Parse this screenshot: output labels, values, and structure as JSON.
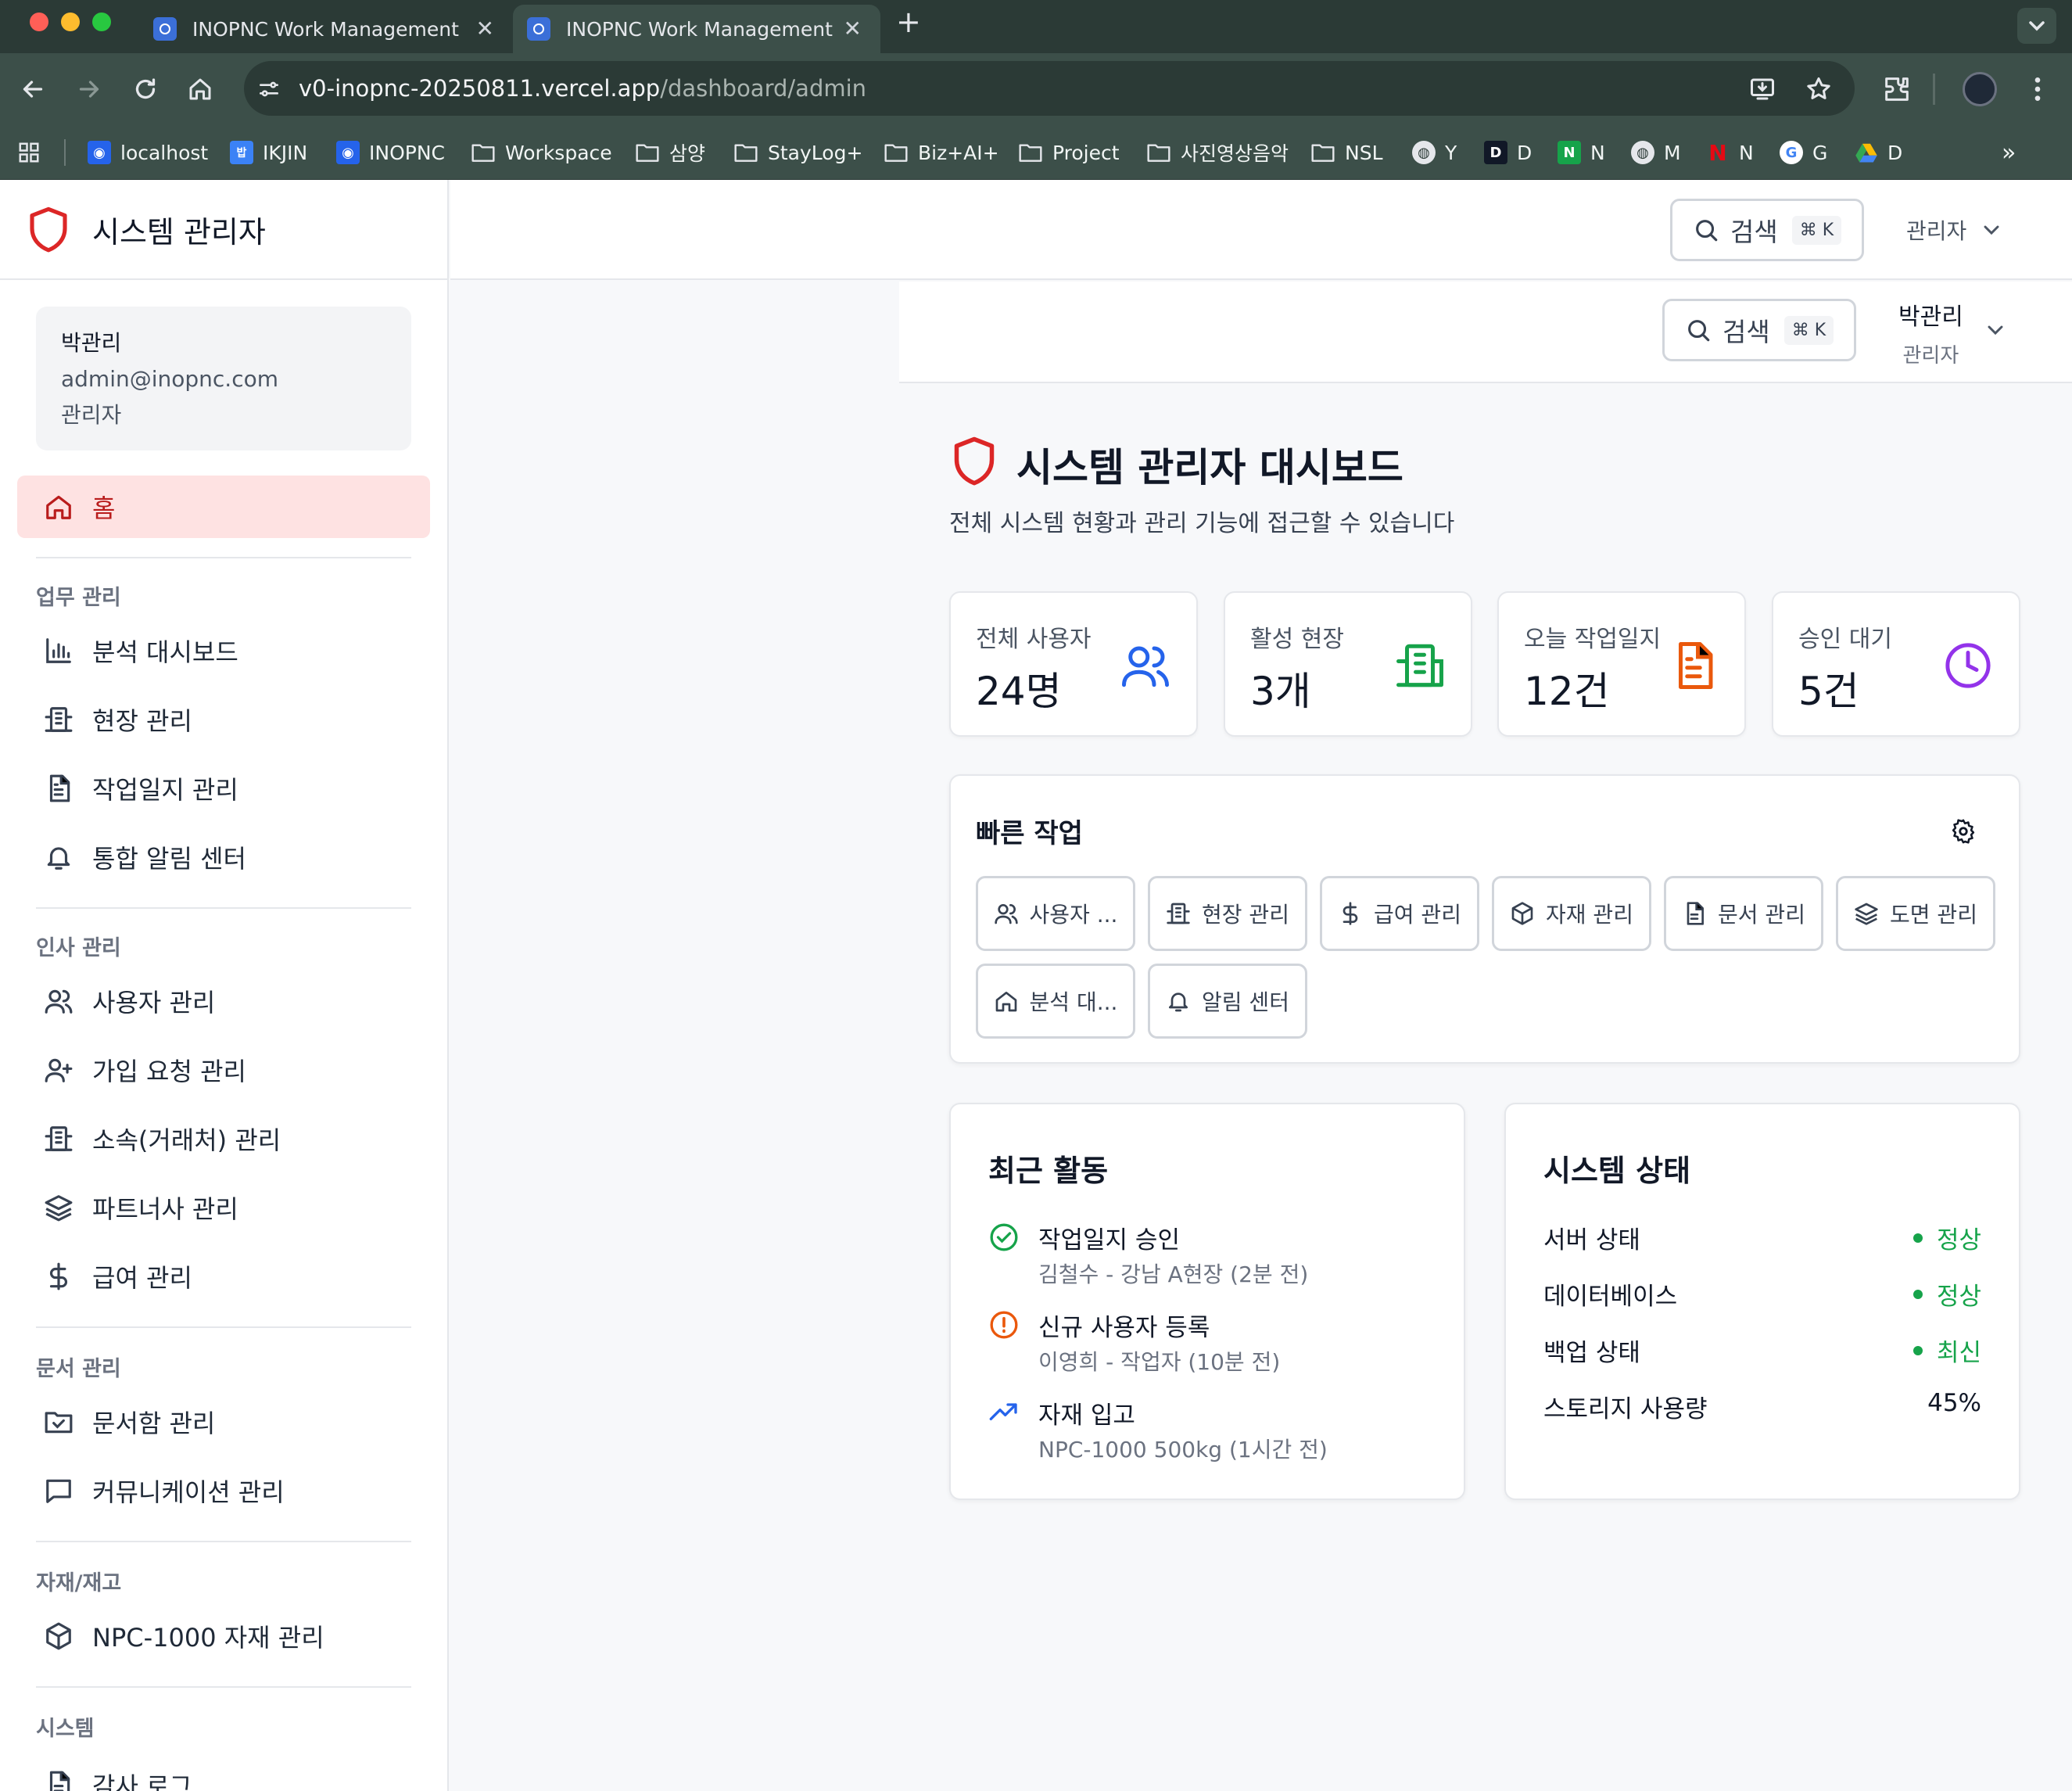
{
  "browser": {
    "tabs": [
      {
        "title": "INOPNC Work Management"
      },
      {
        "title": "INOPNC Work Management"
      }
    ],
    "url_host": "v0-inopnc-20250811.vercel.app",
    "url_path": "/dashboard/admin",
    "bookmarks": [
      "localhost",
      "IKJIN",
      "INOPNC",
      "Workspace",
      "삼양",
      "StayLog+",
      "Biz+AI+",
      "Project",
      "사진영상음악",
      "NSL",
      "Y",
      "D",
      "N",
      "M",
      "N",
      "G",
      "D"
    ]
  },
  "sidebar": {
    "title": "시스템 관리자",
    "user": {
      "name": "박관리",
      "email": "admin@inopnc.com",
      "role": "관리자"
    },
    "home": "홈",
    "sections": [
      {
        "label": "업무 관리",
        "items": [
          "분석 대시보드",
          "현장 관리",
          "작업일지 관리",
          "통합 알림 센터"
        ]
      },
      {
        "label": "인사 관리",
        "items": [
          "사용자 관리",
          "가입 요청 관리",
          "소속(거래처) 관리",
          "파트너사 관리",
          "급여 관리"
        ]
      },
      {
        "label": "문서 관리",
        "items": [
          "문서함 관리",
          "커뮤니케이션 관리"
        ]
      },
      {
        "label": "자재/재고",
        "items": [
          "NPC-1000 자재 관리"
        ]
      },
      {
        "label": "시스템",
        "items": [
          "감사 로그"
        ]
      }
    ]
  },
  "topbar": {
    "search": "검색",
    "shortcut": "⌘ K",
    "user_role": "관리자"
  },
  "header2": {
    "search": "검색",
    "shortcut": "⌘ K",
    "user_name": "박관리",
    "user_role": "관리자"
  },
  "dashboard": {
    "title": "시스템 관리자 대시보드",
    "subtitle": "전체 시스템 현황과 관리 기능에 접근할 수 있습니다",
    "stats": [
      {
        "label": "전체 사용자",
        "value": "24명",
        "icon": "users-icon",
        "color": "#2563eb"
      },
      {
        "label": "활성 현장",
        "value": "3개",
        "icon": "building-icon",
        "color": "#16a34a"
      },
      {
        "label": "오늘 작업일지",
        "value": "12건",
        "icon": "document-icon",
        "color": "#ea580c"
      },
      {
        "label": "승인 대기",
        "value": "5건",
        "icon": "clock-icon",
        "color": "#9333ea"
      }
    ],
    "quick": {
      "title": "빠른 작업",
      "buttons": [
        "사용자 ...",
        "현장 관리",
        "급여 관리",
        "자재 관리",
        "문서 관리",
        "도면 관리",
        "분석 대...",
        "알림 센터"
      ]
    },
    "activity": {
      "title": "최근 활동",
      "items": [
        {
          "title": "작업일지 승인",
          "sub": "김철수 - 강남 A현장 (2분 전)",
          "icon": "check-circle-icon"
        },
        {
          "title": "신규 사용자 등록",
          "sub": "이영희 - 작업자 (10분 전)",
          "icon": "alert-circle-icon"
        },
        {
          "title": "자재 입고",
          "sub": "NPC-1000 500kg (1시간 전)",
          "icon": "trending-up-icon"
        }
      ]
    },
    "status": {
      "title": "시스템 상태",
      "rows": [
        {
          "label": "서버 상태",
          "value": "정상"
        },
        {
          "label": "데이터베이스",
          "value": "정상"
        },
        {
          "label": "백업 상태",
          "value": "최신"
        },
        {
          "label": "스토리지 사용량",
          "value": "45%"
        }
      ]
    }
  }
}
